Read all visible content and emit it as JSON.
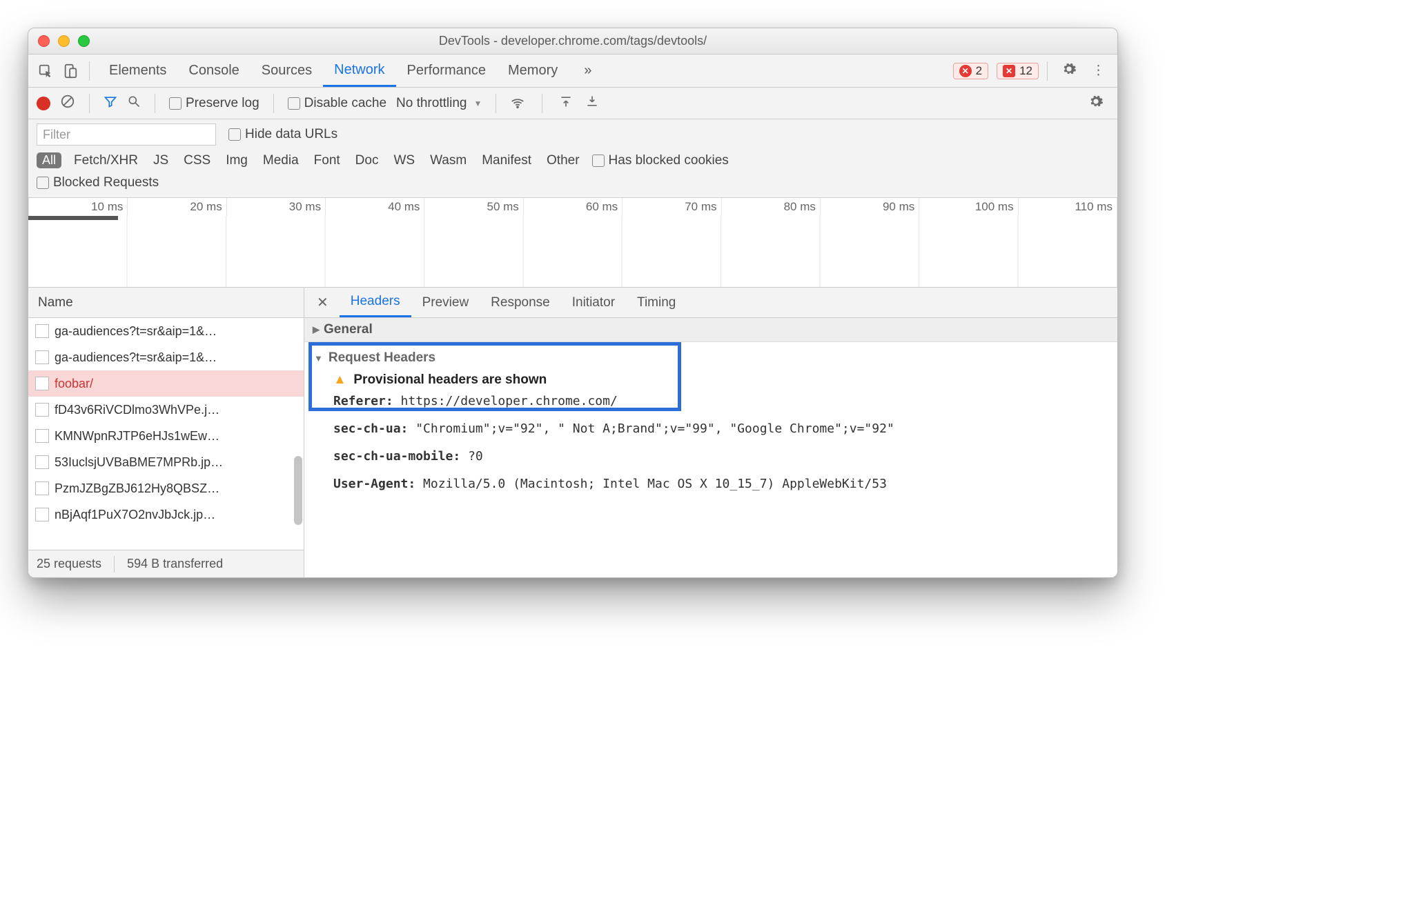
{
  "window": {
    "title": "DevTools - developer.chrome.com/tags/devtools/"
  },
  "tabs": {
    "items": [
      "Elements",
      "Console",
      "Sources",
      "Network",
      "Performance",
      "Memory"
    ],
    "active": "Network",
    "overflow": "»",
    "errors": "2",
    "issues": "12"
  },
  "toolbar": {
    "preserve": "Preserve log",
    "disable_cache": "Disable cache",
    "throttle": "No throttling"
  },
  "filter": {
    "placeholder": "Filter",
    "hide_urls": "Hide data URLs",
    "all": "All",
    "types": [
      "Fetch/XHR",
      "JS",
      "CSS",
      "Img",
      "Media",
      "Font",
      "Doc",
      "WS",
      "Wasm",
      "Manifest",
      "Other"
    ],
    "blocked_cookies": "Has blocked cookies",
    "blocked_requests": "Blocked Requests"
  },
  "timeline": {
    "ticks": [
      "10 ms",
      "20 ms",
      "30 ms",
      "40 ms",
      "50 ms",
      "60 ms",
      "70 ms",
      "80 ms",
      "90 ms",
      "100 ms",
      "110 ms"
    ]
  },
  "list": {
    "header": "Name",
    "rows": [
      {
        "name": "ga-audiences?t=sr&aip=1&…",
        "sel": false
      },
      {
        "name": "ga-audiences?t=sr&aip=1&…",
        "sel": false
      },
      {
        "name": "foobar/",
        "sel": true
      },
      {
        "name": "fD43v6RiVCDlmo3WhVPe.j…",
        "sel": false
      },
      {
        "name": "KMNWpnRJTP6eHJs1wEw…",
        "sel": false
      },
      {
        "name": "53IuclsjUVBaBME7MPRb.jp…",
        "sel": false
      },
      {
        "name": "PzmJZBgZBJ612Hy8QBSZ…",
        "sel": false
      },
      {
        "name": "nBjAqf1PuX7O2nvJbJck.jp…",
        "sel": false
      }
    ],
    "status": {
      "requests": "25 requests",
      "transferred": "594 B transferred"
    }
  },
  "detail": {
    "tabs": [
      "Headers",
      "Preview",
      "Response",
      "Initiator",
      "Timing"
    ],
    "active": "Headers",
    "general": "General",
    "req_headers": "Request Headers",
    "provisional": "Provisional headers are shown",
    "headers": [
      {
        "k": "Referer:",
        "v": " https://developer.chrome.com/"
      },
      {
        "k": "sec-ch-ua:",
        "v": " \"Chromium\";v=\"92\", \" Not A;Brand\";v=\"99\", \"Google Chrome\";v=\"92\""
      },
      {
        "k": "sec-ch-ua-mobile:",
        "v": " ?0"
      },
      {
        "k": "User-Agent:",
        "v": " Mozilla/5.0 (Macintosh; Intel Mac OS X 10_15_7) AppleWebKit/53"
      }
    ]
  }
}
